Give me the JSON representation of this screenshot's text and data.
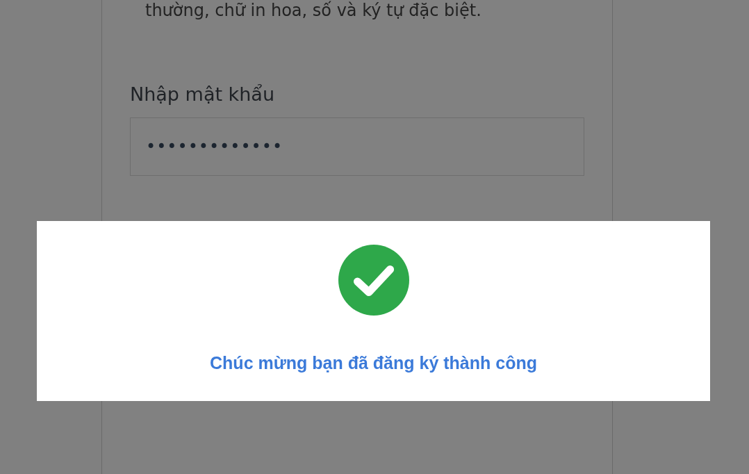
{
  "form": {
    "hint": "thường, chữ in hoa, số và ký tự đặc biệt.",
    "password_label": "Nhập mật khẩu",
    "password_value": "•••••••••••••"
  },
  "dialog": {
    "message": "Chúc mừng bạn đã đăng ký thành công"
  }
}
